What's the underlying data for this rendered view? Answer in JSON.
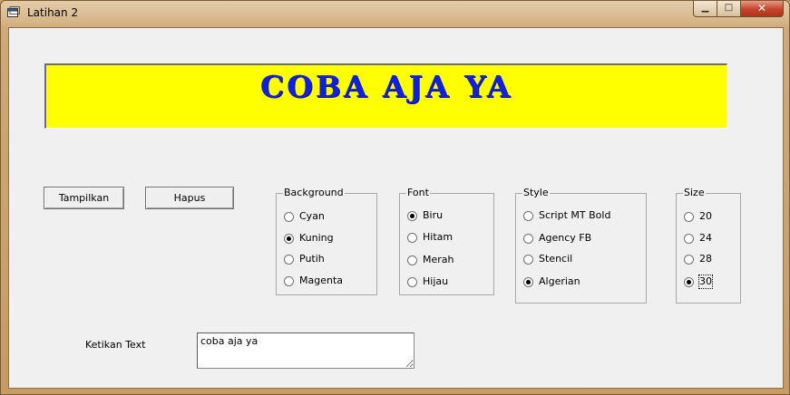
{
  "window": {
    "title": "Latihan 2",
    "controls": {
      "minimize": "▁",
      "maximize": "□",
      "close": "✕"
    }
  },
  "banner": {
    "text": "coba aja ya",
    "background_color": "#ffff00",
    "text_color": "#1020e0"
  },
  "buttons": {
    "show": "Tampilkan",
    "clear": "Hapus"
  },
  "frames": {
    "background": {
      "caption": "Background",
      "options": [
        "Cyan",
        "Kuning",
        "Putih",
        "Magenta"
      ],
      "selected": "Kuning"
    },
    "font": {
      "caption": "Font",
      "options": [
        "Biru",
        "Hitam",
        "Merah",
        "Hijau"
      ],
      "selected": "Biru"
    },
    "style": {
      "caption": "Style",
      "options": [
        "Script MT Bold",
        "Agency FB",
        "Stencil",
        "Algerian"
      ],
      "selected": "Algerian"
    },
    "size": {
      "caption": "Size",
      "options": [
        "20",
        "24",
        "28",
        "30"
      ],
      "selected": "30"
    }
  },
  "input": {
    "label": "Ketikan Text",
    "value": "coba aja ya"
  }
}
